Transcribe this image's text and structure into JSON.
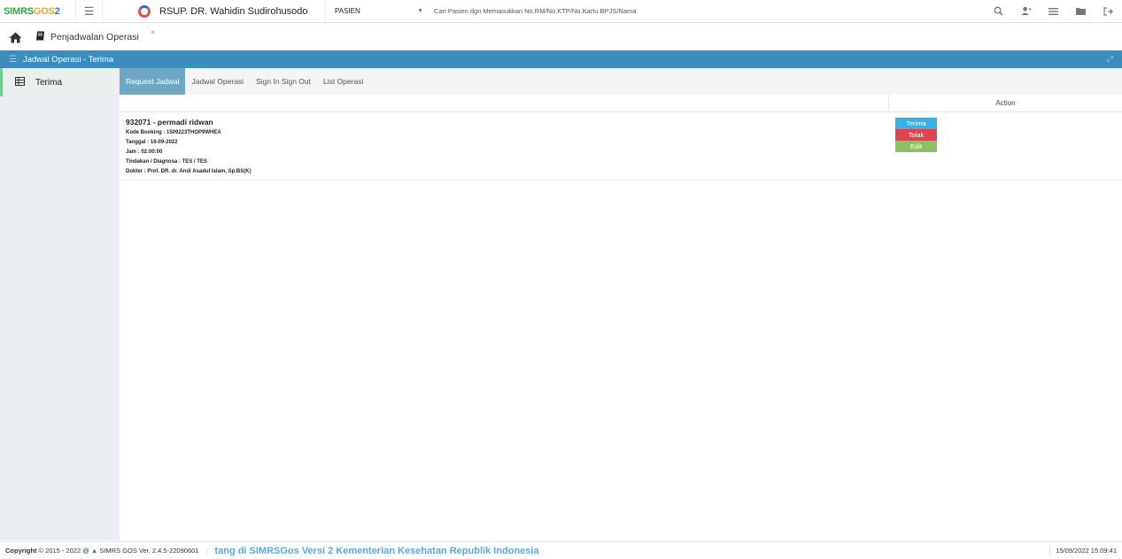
{
  "app": {
    "logo_parts": [
      "SIMRS",
      "GOS",
      "2"
    ],
    "hospital_name": "RSUP. DR. Wahidin Sudirohusodo"
  },
  "topbar": {
    "pasien_label": "PASIEN",
    "search_placeholder": "Cari Pasien dgn Memasukkan No.RM/No.KTP/No.Kartu BPJS/Nama",
    "icons": [
      "search-icon",
      "add-user-icon",
      "list-icon",
      "folder-icon",
      "logout-icon"
    ]
  },
  "tabs": {
    "page_tab_label": "Penjadwalan Operasi",
    "close_glyph": "×"
  },
  "titlebar": {
    "title": "Jadwal Operasi - Terima"
  },
  "sidebar": {
    "items": [
      {
        "label": "Terima",
        "icon": "table-icon"
      }
    ]
  },
  "subtabs": [
    {
      "label": "Request Jadwal",
      "active": true
    },
    {
      "label": "Jadwal Operasi",
      "active": false
    },
    {
      "label": "Sign In Sign Out",
      "active": false
    },
    {
      "label": "List Operasi",
      "active": false
    }
  ],
  "table": {
    "action_header": "Action",
    "rows": [
      {
        "title": "932071 - permadi ridwan",
        "kode_booking": "Kode Booking : 1509223THOP9WHEA",
        "tanggal": "Tanggal : 16-09-2022",
        "jam": "Jam : 02:00:00",
        "tindakan": "Tindakan / Diagnosa : TES / TES",
        "dokter": "Dokter : Prof. DR. dr. Andi Asadul Islam, Sp.BS(K)",
        "actions": {
          "terima": "Terima",
          "tolak": "Tolak",
          "edit": "Edit"
        }
      }
    ]
  },
  "footer": {
    "copyright_label": "Copyright",
    "copyright_years": "2015 - 2022 @",
    "version": "SIMRS GOS Ver. 2.4.5-22090601",
    "marquee": "tang di SIMRSGos Versi 2 Kementerian Kesehatan Republik Indonesia",
    "datetime": "15/09/2022 15:09:41"
  },
  "colors": {
    "header_blue": "#3c8dbc",
    "active_subtab": "#6fa8c7",
    "btn_terima": "#36b3e6",
    "btn_tolak": "#e0434f",
    "btn_edit": "#8cc063",
    "sidebar_accent": "#6fcf97"
  }
}
